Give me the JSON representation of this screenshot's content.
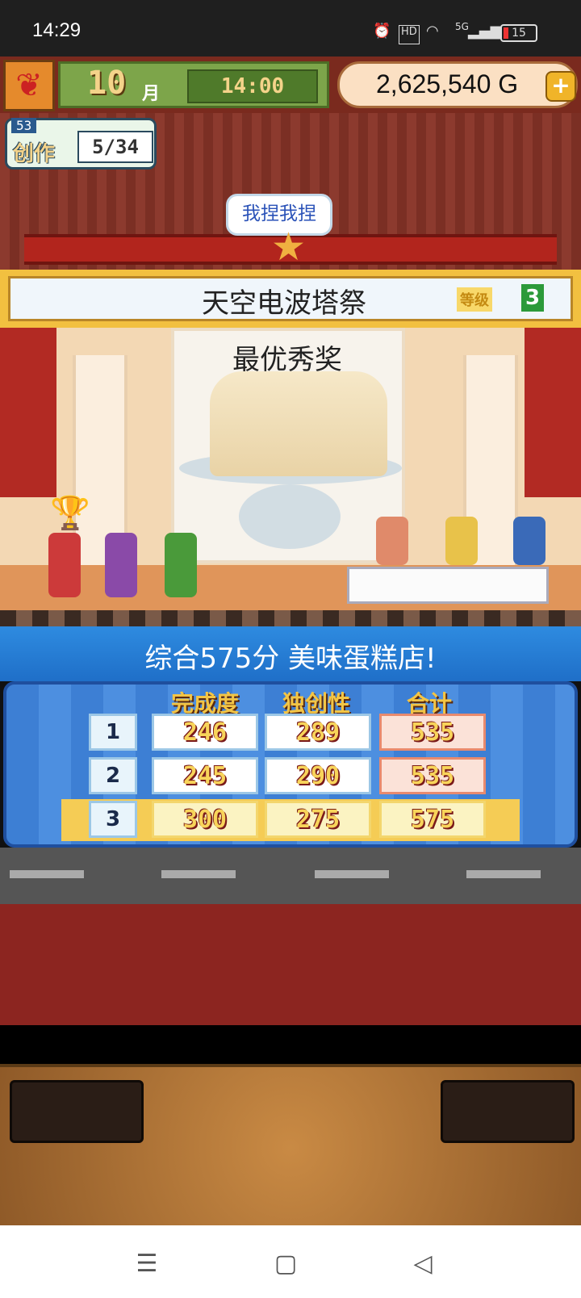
{
  "status_bar": {
    "time": "14:29",
    "icons": [
      "alarm-icon",
      "hd-icon",
      "wifi-icon",
      "5g-signal-icon"
    ],
    "network_label": "5G",
    "battery": "15"
  },
  "header": {
    "month": "10",
    "month_unit": "月",
    "clock": "14:00",
    "money": "2,625,540 G",
    "plus": "+"
  },
  "skill": {
    "level": "53",
    "label": "创作",
    "progress": "5/34"
  },
  "bubble": "我捏我捏",
  "event": {
    "title": "天空电波塔祭",
    "rank_tag": "等级",
    "rank_num": "3"
  },
  "award": {
    "title": "最优秀奖"
  },
  "result": {
    "text": "综合575分 美味蛋糕店!"
  },
  "score_table": {
    "headers": [
      "完成度",
      "独创性",
      "合计"
    ],
    "rows": [
      {
        "rank": "1",
        "completion": "246",
        "originality": "289",
        "total": "535"
      },
      {
        "rank": "2",
        "completion": "245",
        "originality": "290",
        "total": "535"
      },
      {
        "rank": "3",
        "completion": "300",
        "originality": "275",
        "total": "575"
      }
    ]
  },
  "nav": {
    "menu": "☰",
    "home": "▢",
    "back": "◁"
  },
  "colors": {
    "result_blue": "#2e8be0",
    "highlight_gold": "#f5cc55",
    "score_text": "#f8d45a"
  }
}
